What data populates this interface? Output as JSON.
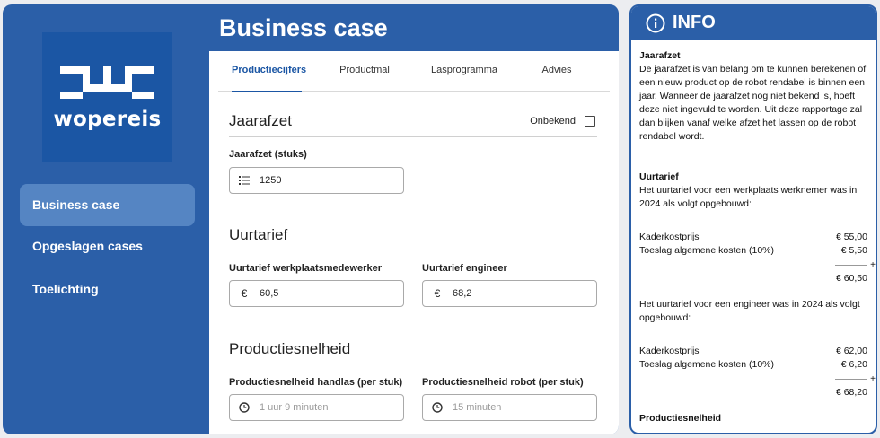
{
  "brand": {
    "logo_text": "wopereis"
  },
  "nav": [
    {
      "label": "Business case",
      "active": true
    },
    {
      "label": "Opgeslagen cases",
      "active": false
    },
    {
      "label": "Toelichting",
      "active": false
    }
  ],
  "page_title": "Business case",
  "tabs": [
    "Productiecijfers",
    "Productmal",
    "Lasprogramma",
    "Advies"
  ],
  "sections": {
    "jaarafzet": {
      "title": "Jaarafzet",
      "unknown_label": "Onbekend",
      "field_label": "Jaarafzet (stuks)",
      "value": "1250"
    },
    "uurtarief": {
      "title": "Uurtarief",
      "worker_label": "Uurtarief werkplaatsmedewerker",
      "worker_value": "60,5",
      "engineer_label": "Uurtarief engineer",
      "engineer_value": "68,2",
      "currency": "€"
    },
    "productiesnelheid": {
      "title": "Productiesnelheid",
      "manual_label": "Productiesnelheid handlas (per stuk)",
      "manual_placeholder": "1 uur 9 minuten",
      "robot_label": "Productiesnelheid robot (per stuk)",
      "robot_placeholder": "15 minuten"
    }
  },
  "info": {
    "title": "INFO",
    "jaarafzet_heading": "Jaarafzet",
    "jaarafzet_text": "De jaarafzet is van belang om te kunnen berekenen of een nieuw product op de robot rendabel is binnen een jaar. Wanneer de jaarafzet nog niet bekend is, hoeft deze niet ingevuld te worden. Uit deze rapportage zal dan blijken vanaf welke afzet het lassen op de robot rendabel wordt.",
    "uurtarief_heading": "Uurtarief",
    "uurtarief_text": "Het uurtarief voor een werkplaats werknemer was in 2024 als volgt opgebouwd:",
    "worker_rows": [
      {
        "label": "Kaderkostprijs",
        "amount": "€ 55,00"
      },
      {
        "label": "Toeslag algemene kosten (10%)",
        "amount": "€ 5,50"
      }
    ],
    "worker_total": "€ 60,50",
    "engineer_text": "Het uurtarief voor een engineer was in 2024 als volgt opgebouwd:",
    "engineer_rows": [
      {
        "label": "Kaderkostprijs",
        "amount": "€ 62,00"
      },
      {
        "label": "Toeslag algemene kosten (10%)",
        "amount": "€ 6,20"
      }
    ],
    "engineer_total": "€ 68,20",
    "plus": "+",
    "next_heading": "Productiesnelheid"
  },
  "colors": {
    "primary": "#2b5fa8",
    "logo_bg": "#1b56a4",
    "active_nav": "#5585c3"
  },
  "icons": [
    "list-icon",
    "euro-icon",
    "clock-icon",
    "info-icon"
  ]
}
